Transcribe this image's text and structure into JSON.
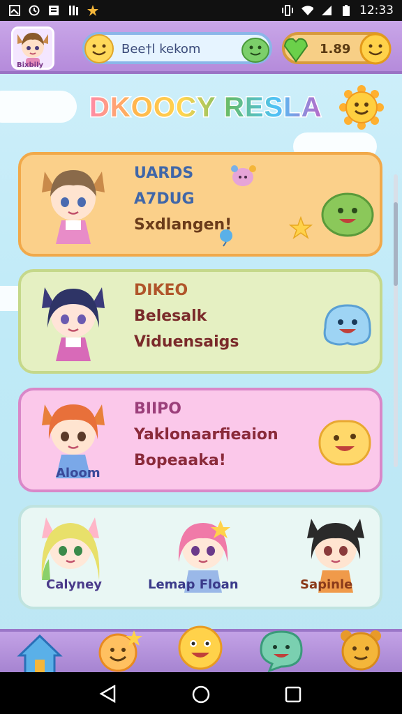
{
  "status_bar": {
    "time": "12:33",
    "icons_left": [
      "gallery-icon",
      "clock-icon",
      "news-icon",
      "books-icon",
      "star-icon"
    ],
    "icons_right": [
      "vibrate-icon",
      "wifi-icon",
      "signal-icon",
      "battery-icon"
    ]
  },
  "header": {
    "avatar_label": "Bixbily",
    "player_name": "Bee†l kekom",
    "gem_count": "1.89"
  },
  "title": "DKOOCY RESLA",
  "cards": [
    {
      "lines": [
        "UARDS",
        "A7DUG",
        "Sxdlangen!"
      ]
    },
    {
      "lines": [
        "DIKEO",
        "Belesalk",
        "Viduensaigs"
      ]
    },
    {
      "lines": [
        "BIIPO",
        "Yaklonaarfieaion",
        "Bopeaaka!"
      ],
      "char_name": "Aloom"
    }
  ],
  "characters": [
    {
      "name": "Calyney"
    },
    {
      "name": "Lemap Floan"
    },
    {
      "name": "Sapinle"
    }
  ],
  "bottom_nav": [
    "home-icon",
    "star-emoji-icon",
    "smile-icon",
    "chat-icon",
    "cat-icon"
  ],
  "colors": {
    "top_bar": "#b58bdb",
    "card_orange": "#fbd08a",
    "card_green": "#e5f0c2",
    "card_pink": "#fbc8ea",
    "card_mint": "#e9f7f4"
  }
}
